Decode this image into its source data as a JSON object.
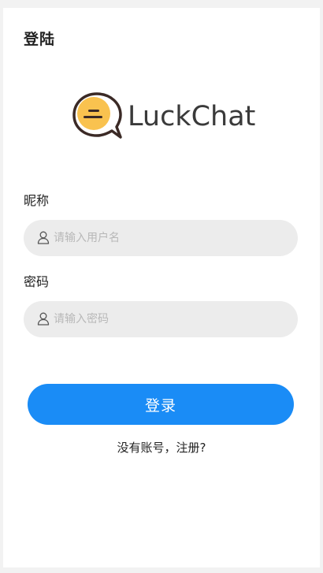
{
  "header": {
    "title": "登陆"
  },
  "logo": {
    "text": "LuckChat",
    "bubble_color": "#f9c24f",
    "outline_color": "#3b2a26"
  },
  "form": {
    "nickname": {
      "label": "昵称",
      "placeholder": "请输入用户名",
      "value": ""
    },
    "password": {
      "label": "密码",
      "placeholder": "请输入密码",
      "value": ""
    }
  },
  "actions": {
    "login_label": "登录",
    "register_label": "没有账号，注册?"
  },
  "icons": {
    "input_icon": "user-icon"
  },
  "colors": {
    "primary": "#1a8cf6",
    "input_bg": "#ececec"
  }
}
